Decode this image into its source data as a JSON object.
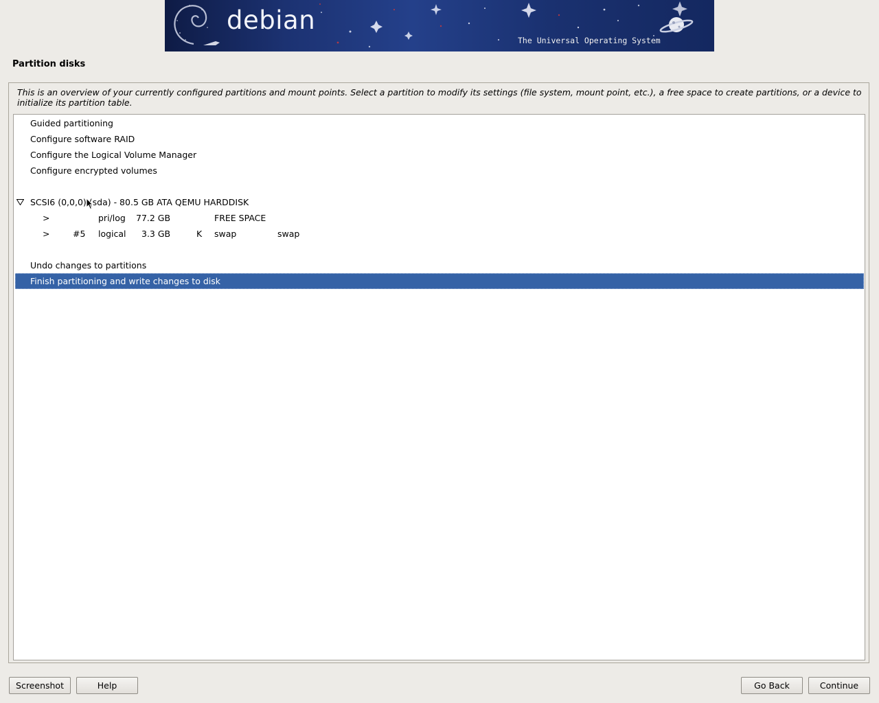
{
  "banner": {
    "brand": "debian",
    "tagline": "The Universal Operating System"
  },
  "page_title": "Partition disks",
  "description": "This is an overview of your currently configured partitions and mount points. Select a partition to modify its settings (file system, mount point, etc.), a free space to create partitions, or a device to initialize its partition table.",
  "menu": {
    "guided": "Guided partitioning",
    "raid": "Configure software RAID",
    "lvm": "Configure the Logical Volume Manager",
    "encrypted": "Configure encrypted volumes"
  },
  "disk": {
    "expander_icon": "triangle-down-icon",
    "label": "SCSI6 (0,0,0) (sda) - 80.5 GB ATA QEMU HARDDISK",
    "partitions": [
      {
        "marker": ">",
        "number": "",
        "type": "pri/log",
        "size": "77.2 GB",
        "flag": "",
        "fs": "FREE SPACE",
        "mount": ""
      },
      {
        "marker": ">",
        "number": "#5",
        "type": "logical",
        "size": "3.3 GB",
        "flag": "K",
        "fs": "swap",
        "mount": "swap"
      }
    ]
  },
  "actions": {
    "undo": "Undo changes to partitions",
    "finish": "Finish partitioning and write changes to disk"
  },
  "selected_item": "Finish partitioning and write changes to disk",
  "buttons": {
    "screenshot": "Screenshot",
    "help": "Help",
    "go_back": "Go Back",
    "continue": "Continue"
  },
  "colors": {
    "background": "#edebe7",
    "selection": "#3562a6",
    "banner": "#1c3272"
  }
}
